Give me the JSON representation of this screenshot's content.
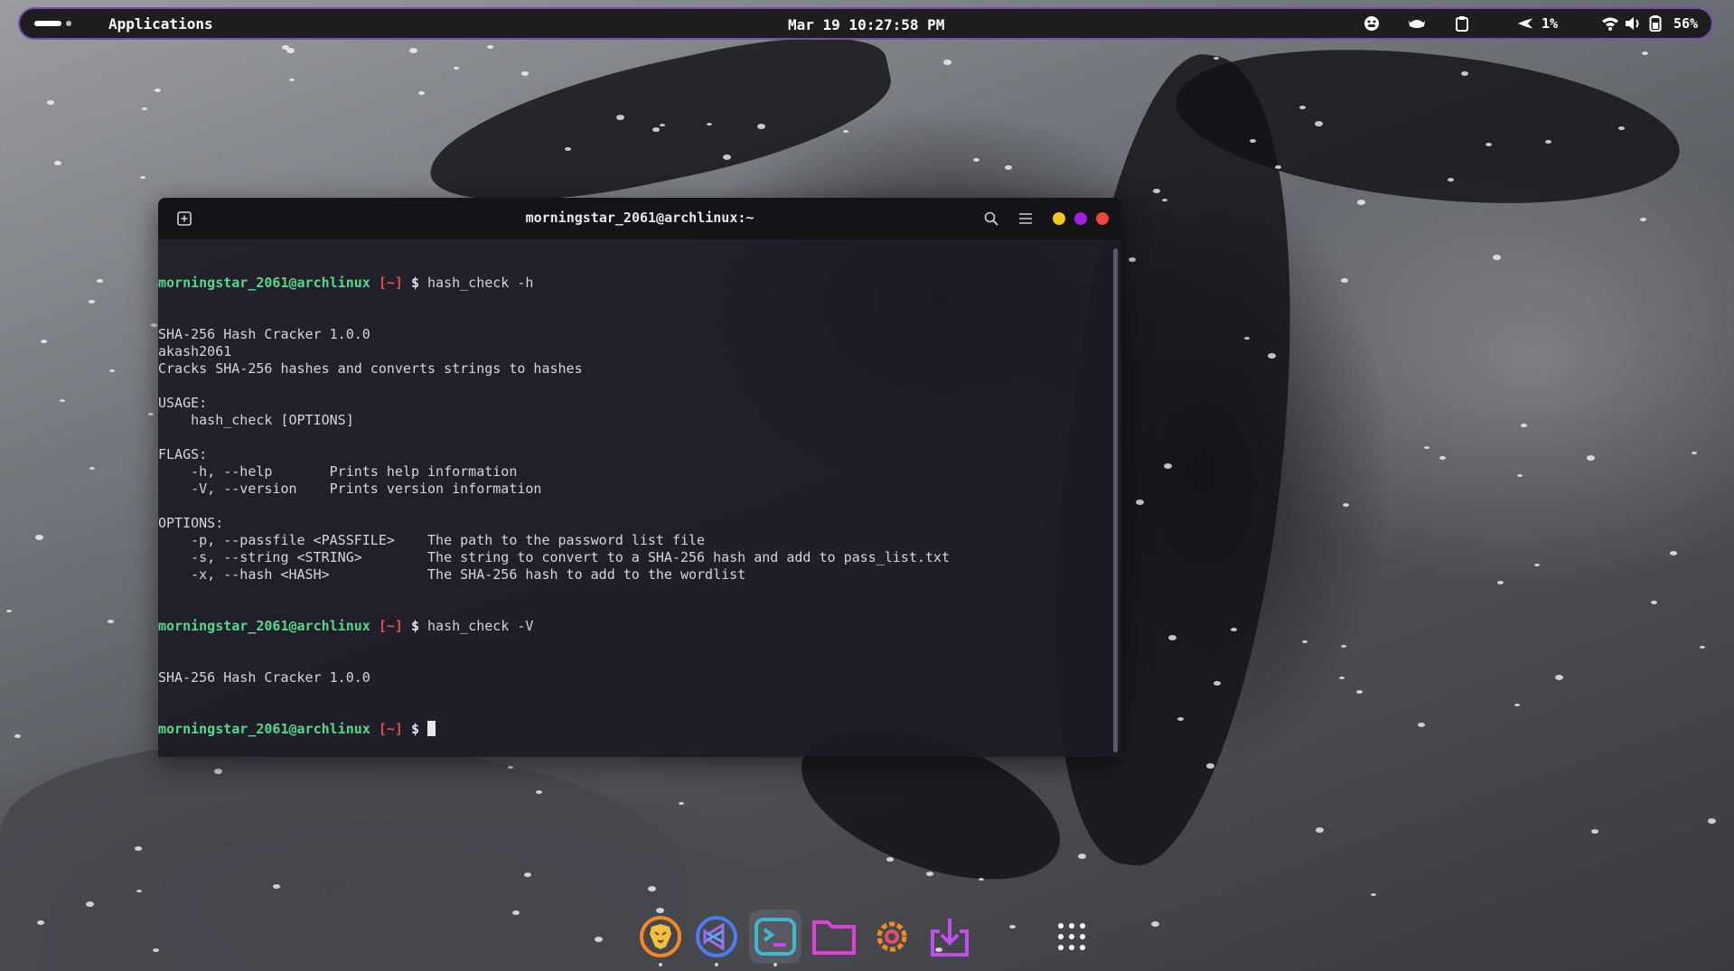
{
  "topbar": {
    "applications_label": "Applications",
    "clock": "Mar 19 10:27:58 PM",
    "cpu_percent": "1%",
    "battery_percent": "56%",
    "icons": [
      "emoji-icon",
      "weather-icon",
      "clipboard-icon",
      "caffeine-icon",
      "wifi-icon",
      "volume-icon",
      "battery-icon"
    ]
  },
  "terminal": {
    "title": "morningstar_2061@archlinux:~",
    "prompt_user": "morningstar_2061@archlinux",
    "prompt_dir": "[~]",
    "prompt_symbol": "$",
    "commands": [
      "hash_check -h",
      "hash_check -V"
    ],
    "output_lines": [
      "SHA-256 Hash Cracker 1.0.0",
      "akash2061",
      "Cracks SHA-256 hashes and converts strings to hashes",
      "",
      "USAGE:",
      "    hash_check [OPTIONS]",
      "",
      "FLAGS:",
      "    -h, --help       Prints help information",
      "    -V, --version    Prints version information",
      "",
      "OPTIONS:",
      "    -p, --passfile <PASSFILE>    The path to the password list file",
      "    -s, --string <STRING>        The string to convert to a SHA-256 hash and add to pass_list.txt",
      "    -x, --hash <HASH>            The SHA-256 hash to add to the wordlist"
    ],
    "version_output": "SHA-256 Hash Cracker 1.0.0",
    "button_colors": {
      "minimize": "#f5c518",
      "maximize": "#a020e0",
      "close": "#f0433a"
    }
  },
  "dock": {
    "items": [
      "brave-browser-icon",
      "vscode-icon",
      "terminal-icon",
      "files-icon",
      "settings-icon",
      "software-update-icon",
      "app-grid-icon"
    ]
  },
  "colors": {
    "accent": "#7a4fb0",
    "prompt_user": "#55d98a",
    "prompt_dir": "#e0504f"
  }
}
